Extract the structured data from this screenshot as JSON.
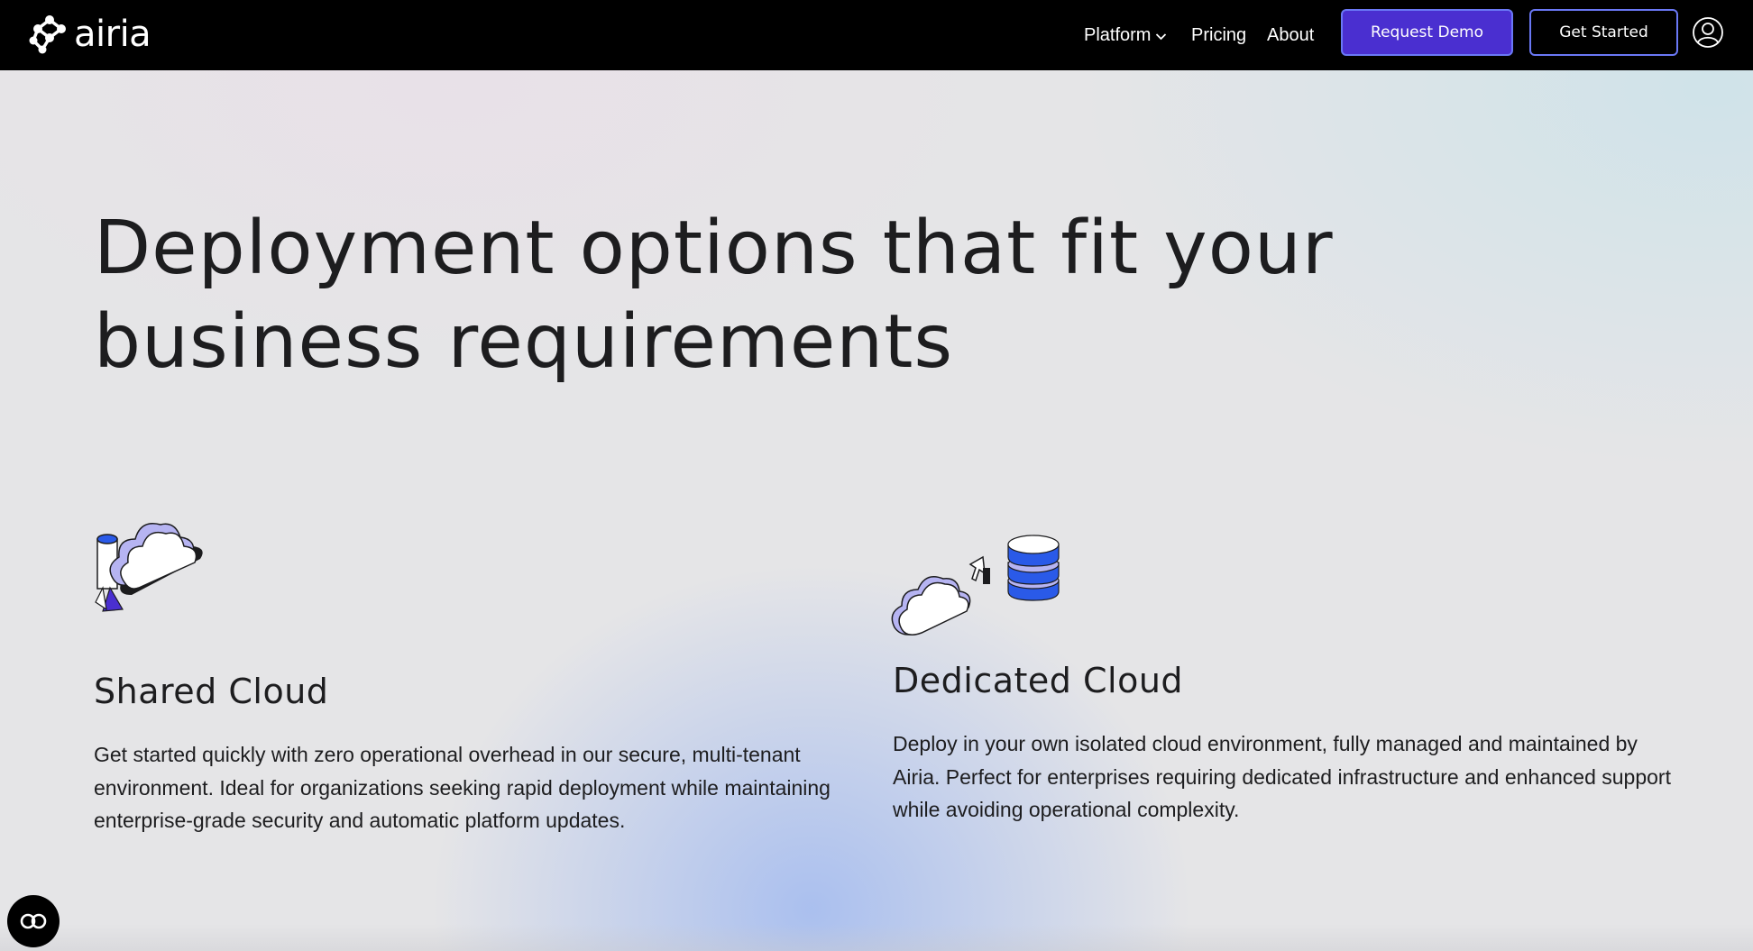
{
  "header": {
    "logo_text": "airia",
    "nav": {
      "platform_label": "Platform",
      "pricing_label": "Pricing",
      "about_label": "About"
    },
    "request_demo_label": "Request Demo",
    "get_started_label": "Get Started"
  },
  "hero": {
    "title_line1": "Deployment options that fit your",
    "title_line2": "business requirements"
  },
  "cards": [
    {
      "title": "Shared Cloud",
      "description": "Get started quickly with zero operational overhead in our secure, multi-tenant environment. Ideal for organizations seeking rapid deployment while maintaining enterprise-grade security and automatic platform updates.",
      "icon": "shared-cloud-icon"
    },
    {
      "title": "Dedicated Cloud",
      "description": "Deploy in your own isolated cloud environment, fully managed and maintained by Airia. Perfect for enterprises requiring dedicated infrastructure and enhanced support while avoiding operational complexity.",
      "icon": "dedicated-cloud-icon"
    }
  ],
  "colors": {
    "header_bg": "#000000",
    "accent": "#4a2fd0",
    "button_border": "#6a78f5",
    "cloud_lavender": "#b6b4f2",
    "db_blue": "#2a5ae8"
  }
}
